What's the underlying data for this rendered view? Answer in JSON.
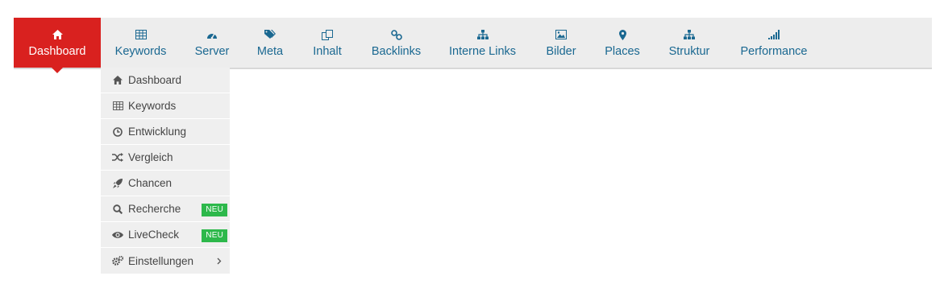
{
  "nav": {
    "items": [
      {
        "label": "Dashboard",
        "icon": "home-icon",
        "active": true
      },
      {
        "label": "Keywords",
        "icon": "table-icon"
      },
      {
        "label": "Server",
        "icon": "dashboard-gauge-icon"
      },
      {
        "label": "Meta",
        "icon": "tags-icon"
      },
      {
        "label": "Inhalt",
        "icon": "copy-icon"
      },
      {
        "label": "Backlinks",
        "icon": "link-icon"
      },
      {
        "label": "Interne Links",
        "icon": "sitemap-icon"
      },
      {
        "label": "Bilder",
        "icon": "image-icon"
      },
      {
        "label": "Places",
        "icon": "map-marker-icon"
      },
      {
        "label": "Struktur",
        "icon": "sitemap-icon"
      },
      {
        "label": "Performance",
        "icon": "signal-icon"
      }
    ],
    "accent_color": "#d9211f",
    "link_color": "#1a6891"
  },
  "dropdown": {
    "items": [
      {
        "label": "Dashboard",
        "icon": "home-icon"
      },
      {
        "label": "Keywords",
        "icon": "table-icon"
      },
      {
        "label": "Entwicklung",
        "icon": "clock-icon"
      },
      {
        "label": "Vergleich",
        "icon": "shuffle-icon"
      },
      {
        "label": "Chancen",
        "icon": "rocket-icon"
      },
      {
        "label": "Recherche",
        "icon": "search-icon",
        "badge": "NEU"
      },
      {
        "label": "LiveCheck",
        "icon": "eye-icon",
        "badge": "NEU"
      },
      {
        "label": "Einstellungen",
        "icon": "cogs-icon",
        "submenu": true
      }
    ],
    "badge_color": "#2db84b"
  }
}
